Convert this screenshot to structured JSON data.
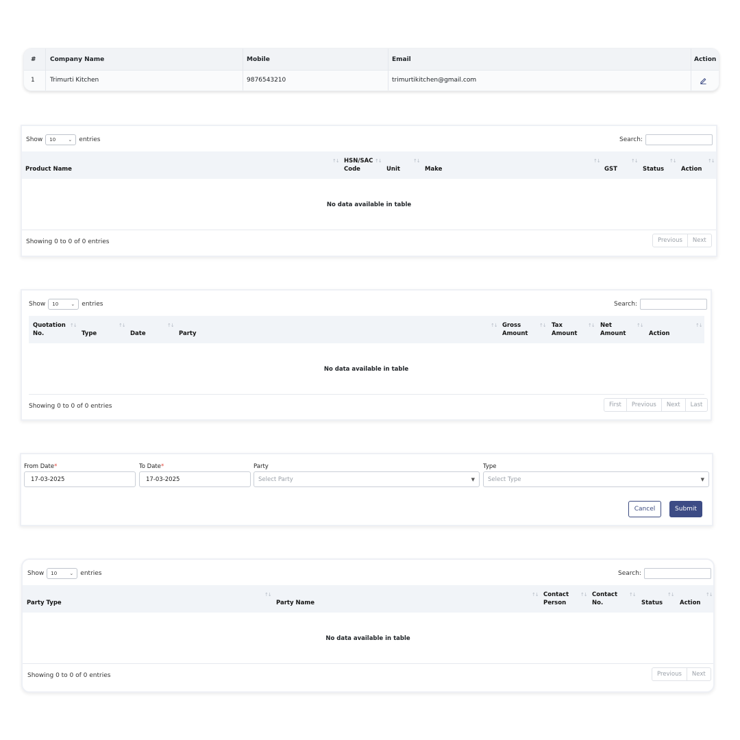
{
  "company_table": {
    "columns": [
      "#",
      "Company Name",
      "Mobile",
      "Email",
      "Action"
    ],
    "rows": [
      {
        "index": "1",
        "company_name": "Trimurti Kitchen",
        "mobile": "9876543210",
        "email": "trimurtikitchen@gmail.com"
      }
    ]
  },
  "product_table": {
    "show_label": "Show",
    "entries_value": "10",
    "entries_label": "entries",
    "search_label": "Search:",
    "columns": [
      "Product Name",
      "HSN/SAC Code",
      "Unit",
      "Make",
      "GST",
      "Status",
      "Action"
    ],
    "col_hsn_1": "HSN/SAC",
    "col_hsn_2": "Code",
    "empty_text": "No data available in table",
    "info_text": "Showing 0 to 0 of 0 entries",
    "pager": [
      "Previous",
      "Next"
    ]
  },
  "quotation_table": {
    "show_label": "Show",
    "entries_value": "10",
    "entries_label": "entries",
    "search_label": "Search:",
    "col_quotation_1": "Quotation",
    "col_quotation_2": "No.",
    "col_type": "Type",
    "col_date": "Date",
    "col_party": "Party",
    "col_gross_1": "Gross",
    "col_gross_2": "Amount",
    "col_tax_1": "Tax",
    "col_tax_2": "Amount",
    "col_net_1": "Net",
    "col_net_2": "Amount",
    "col_action": "Action",
    "empty_text": "No data available in table",
    "info_text": "Showing 0 to 0 of 0 entries",
    "pager": [
      "First",
      "Previous",
      "Next",
      "Last"
    ]
  },
  "report_form": {
    "from_date_label": "From Date",
    "from_date_value": "17-03-2025",
    "to_date_label": "To Date",
    "to_date_value": "17-03-2025",
    "required_mark": "*",
    "party_label": "Party",
    "party_placeholder": "Select Party",
    "type_label": "Type",
    "type_placeholder": "Select Type",
    "cancel_label": "Cancel",
    "submit_label": "Submit"
  },
  "party_table": {
    "show_label": "Show",
    "entries_value": "10",
    "entries_label": "entries",
    "search_label": "Search:",
    "col_party_type": "Party Type",
    "col_party_name": "Party Name",
    "col_contact_person_1": "Contact",
    "col_contact_person_2": "Person",
    "col_contact_no_1": "Contact",
    "col_contact_no_2": "No.",
    "col_status": "Status",
    "col_action": "Action",
    "empty_text": "No data available in table",
    "info_text": "Showing 0 to 0 of 0 entries",
    "pager": [
      "Previous",
      "Next"
    ]
  },
  "icons": {
    "edit": "pencil-icon",
    "sort": "sort-arrows-icon",
    "dropdown": "chevron-down-icon"
  },
  "colors": {
    "primary": "#3d4c85",
    "required": "#e0473b",
    "header_bg": "#f1f4f8"
  }
}
